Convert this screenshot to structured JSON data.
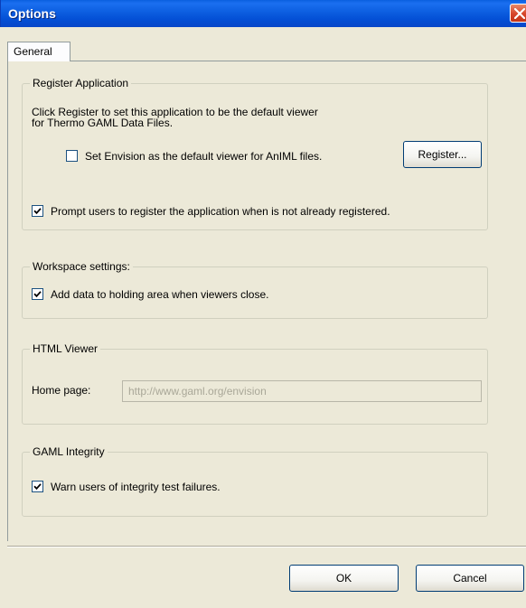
{
  "window": {
    "title": "Options"
  },
  "tabs": [
    {
      "label": "General"
    }
  ],
  "register_application": {
    "title": "Register Application",
    "description_line1": "Click Register to set this application to be the default viewer",
    "description_line2": "for Thermo GAML Data Files.",
    "set_default_label": "Set Envision as the default viewer for AnIML files.",
    "set_default_checked": false,
    "register_button": "Register...",
    "prompt_label": "Prompt users to register the application when is not already registered.",
    "prompt_checked": true
  },
  "workspace_settings": {
    "title": "Workspace settings:",
    "holding_area_label": "Add data to holding area when viewers close.",
    "holding_area_checked": true
  },
  "html_viewer": {
    "title": "HTML Viewer",
    "home_page_label": "Home page:",
    "home_page_value": "http://www.gaml.org/envision"
  },
  "gaml_integrity": {
    "title": "GAML Integrity",
    "warn_label": "Warn users of integrity test failures.",
    "warn_checked": true
  },
  "footer": {
    "ok_label": "OK",
    "cancel_label": "Cancel"
  }
}
